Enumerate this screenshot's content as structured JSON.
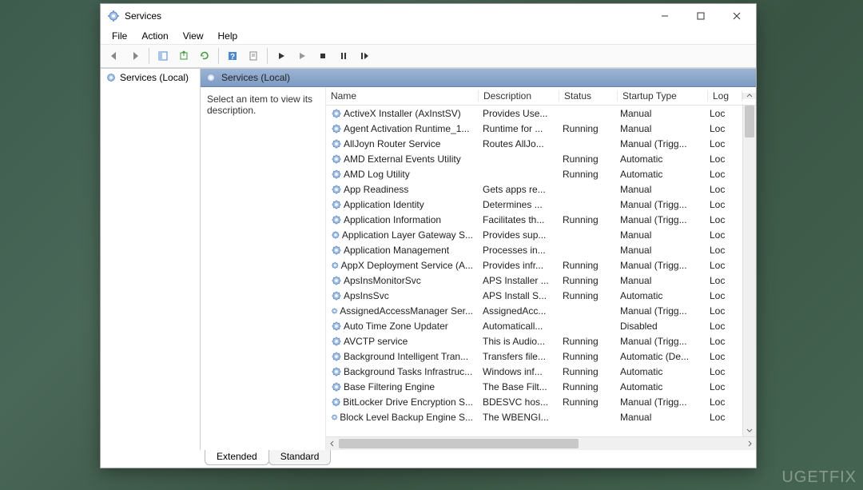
{
  "window": {
    "title": "Services"
  },
  "menubar": [
    "File",
    "Action",
    "View",
    "Help"
  ],
  "left_pane": {
    "item": "Services (Local)"
  },
  "right_header": "Services (Local)",
  "description_hint": "Select an item to view its description.",
  "columns": {
    "name": "Name",
    "description": "Description",
    "status": "Status",
    "startup": "Startup Type",
    "logon": "Log"
  },
  "services": [
    {
      "name": "ActiveX Installer (AxInstSV)",
      "desc": "Provides Use...",
      "status": "",
      "startup": "Manual",
      "logon": "Loc"
    },
    {
      "name": "Agent Activation Runtime_1...",
      "desc": "Runtime for ...",
      "status": "Running",
      "startup": "Manual",
      "logon": "Loc"
    },
    {
      "name": "AllJoyn Router Service",
      "desc": "Routes AllJo...",
      "status": "",
      "startup": "Manual (Trigg...",
      "logon": "Loc"
    },
    {
      "name": "AMD External Events Utility",
      "desc": "",
      "status": "Running",
      "startup": "Automatic",
      "logon": "Loc"
    },
    {
      "name": "AMD Log Utility",
      "desc": "",
      "status": "Running",
      "startup": "Automatic",
      "logon": "Loc"
    },
    {
      "name": "App Readiness",
      "desc": "Gets apps re...",
      "status": "",
      "startup": "Manual",
      "logon": "Loc"
    },
    {
      "name": "Application Identity",
      "desc": "Determines ...",
      "status": "",
      "startup": "Manual (Trigg...",
      "logon": "Loc"
    },
    {
      "name": "Application Information",
      "desc": "Facilitates th...",
      "status": "Running",
      "startup": "Manual (Trigg...",
      "logon": "Loc"
    },
    {
      "name": "Application Layer Gateway S...",
      "desc": "Provides sup...",
      "status": "",
      "startup": "Manual",
      "logon": "Loc"
    },
    {
      "name": "Application Management",
      "desc": "Processes in...",
      "status": "",
      "startup": "Manual",
      "logon": "Loc"
    },
    {
      "name": "AppX Deployment Service (A...",
      "desc": "Provides infr...",
      "status": "Running",
      "startup": "Manual (Trigg...",
      "logon": "Loc"
    },
    {
      "name": "ApsInsMonitorSvc",
      "desc": "APS Installer ...",
      "status": "Running",
      "startup": "Manual",
      "logon": "Loc"
    },
    {
      "name": "ApsInsSvc",
      "desc": "APS Install S...",
      "status": "Running",
      "startup": "Automatic",
      "logon": "Loc"
    },
    {
      "name": "AssignedAccessManager Ser...",
      "desc": "AssignedAcc...",
      "status": "",
      "startup": "Manual (Trigg...",
      "logon": "Loc"
    },
    {
      "name": "Auto Time Zone Updater",
      "desc": "Automaticall...",
      "status": "",
      "startup": "Disabled",
      "logon": "Loc"
    },
    {
      "name": "AVCTP service",
      "desc": "This is Audio...",
      "status": "Running",
      "startup": "Manual (Trigg...",
      "logon": "Loc"
    },
    {
      "name": "Background Intelligent Tran...",
      "desc": "Transfers file...",
      "status": "Running",
      "startup": "Automatic (De...",
      "logon": "Loc"
    },
    {
      "name": "Background Tasks Infrastruc...",
      "desc": "Windows inf...",
      "status": "Running",
      "startup": "Automatic",
      "logon": "Loc"
    },
    {
      "name": "Base Filtering Engine",
      "desc": "The Base Filt...",
      "status": "Running",
      "startup": "Automatic",
      "logon": "Loc"
    },
    {
      "name": "BitLocker Drive Encryption S...",
      "desc": "BDESVC hos...",
      "status": "Running",
      "startup": "Manual (Trigg...",
      "logon": "Loc"
    },
    {
      "name": "Block Level Backup Engine S...",
      "desc": "The WBENGI...",
      "status": "",
      "startup": "Manual",
      "logon": "Loc"
    }
  ],
  "tabs": {
    "extended": "Extended",
    "standard": "Standard"
  },
  "watermark": "UGETFIX"
}
